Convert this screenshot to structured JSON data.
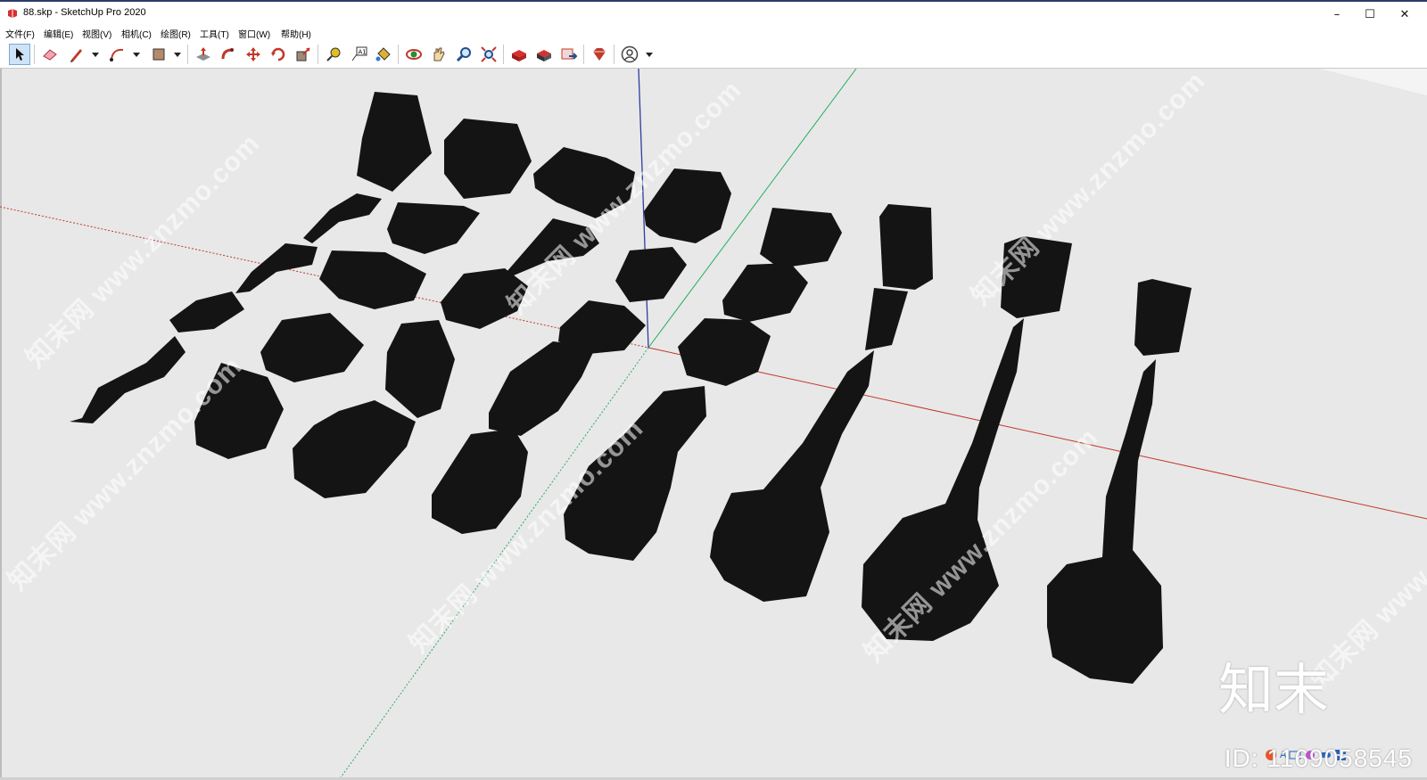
{
  "window": {
    "title": "88.skp - SketchUp Pro 2020",
    "controls": [
      "–",
      "☐",
      "✕"
    ]
  },
  "menubar": {
    "items": [
      "文件(F)",
      "编辑(E)",
      "视图(V)",
      "相机(C)",
      "绘图(R)",
      "工具(T)",
      "窗口(W)",
      "帮助(H)"
    ]
  },
  "toolbar": {
    "tools": [
      {
        "name": "select-icon"
      },
      {
        "name": "eraser-icon"
      },
      {
        "name": "pencil-icon"
      },
      {
        "name": "arc-icon"
      },
      {
        "name": "rectangle-icon"
      },
      {
        "name": "push-pull-icon"
      },
      {
        "name": "follow-me-icon"
      },
      {
        "name": "move-icon"
      },
      {
        "name": "rotate-icon"
      },
      {
        "name": "scale-icon"
      },
      {
        "name": "tape-measure-icon"
      },
      {
        "name": "text-icon"
      },
      {
        "name": "paint-bucket-icon"
      },
      {
        "name": "orbit-icon"
      },
      {
        "name": "pan-icon"
      },
      {
        "name": "zoom-icon"
      },
      {
        "name": "zoom-extents-icon"
      },
      {
        "name": "warehouse-icon"
      },
      {
        "name": "extension-warehouse-icon"
      },
      {
        "name": "send-to-layout-icon"
      },
      {
        "name": "ruby-console-icon"
      },
      {
        "name": "account-icon"
      }
    ]
  },
  "viewport": {
    "watermark": "知末网 www.znzmo.com",
    "brand_logo": "知末",
    "brand_id": "ID: 1169058545",
    "ime_icons": "A"
  },
  "colors": {
    "red_axis": "#c0392b",
    "green_axis": "#27ae60",
    "blue_axis": "#2c3e9e",
    "model_fill": "#141414",
    "viewport_bg": "#e8e8e8"
  }
}
